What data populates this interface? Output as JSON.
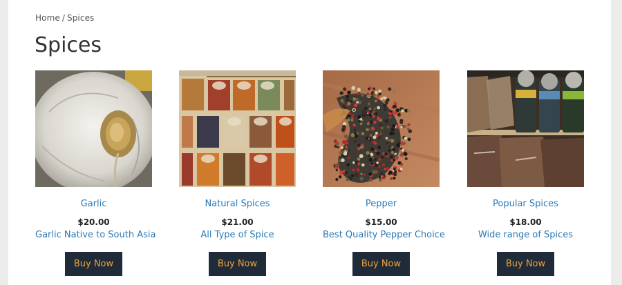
{
  "breadcrumb": {
    "home": "Home",
    "separator": "/",
    "current": "Spices"
  },
  "page": {
    "title": "Spices"
  },
  "colors": {
    "link": "#2a7ab6",
    "button_bg": "#1f2b38",
    "button_text": "#f0a23a"
  },
  "products": [
    {
      "name": "Garlic",
      "price": "$20.00",
      "description": "Garlic Native to South Asia",
      "button": "Buy Now",
      "image": "garlic-photo"
    },
    {
      "name": "Natural Spices",
      "price": "$21.00",
      "description": "All Type of Spice",
      "button": "Buy Now",
      "image": "spice-boxes-photo"
    },
    {
      "name": "Pepper",
      "price": "$15.00",
      "description": "Best Quality Pepper Choice",
      "button": "Buy Now",
      "image": "peppercorns-photo"
    },
    {
      "name": "Popular Spices",
      "price": "$18.00",
      "description": "Wide range of Spices",
      "button": "Buy Now",
      "image": "spice-jars-photo"
    }
  ]
}
